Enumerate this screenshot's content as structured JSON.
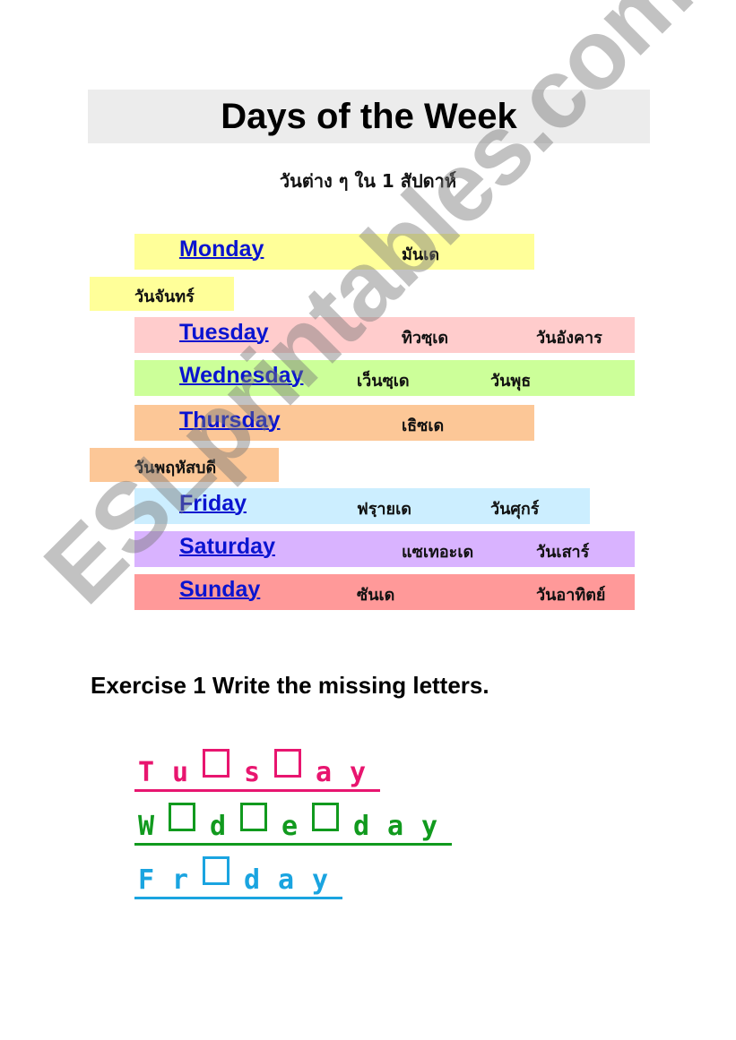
{
  "header": {
    "title": "Days of the Week",
    "subtitle": "วันต่าง ๆ ใน 1 สัปดาห์"
  },
  "days": [
    {
      "english": "Monday",
      "pronunciation": "มันเด",
      "thai": "วันจันทร์",
      "color": "#ffff99"
    },
    {
      "english": "Tuesday",
      "pronunciation": "ทิวซฺเด",
      "thai": "วันอังคาร",
      "color": "#ffcccc"
    },
    {
      "english": "Wednesday",
      "pronunciation": "เว็นซฺเด",
      "thai": "วันพุธ",
      "color": "#ccff99"
    },
    {
      "english": "Thursday",
      "pronunciation": "เธิซเด",
      "thai": "วันพฤหัสบดี",
      "color": "#fcc797"
    },
    {
      "english": "Friday",
      "pronunciation": "ฟรฺายเด",
      "thai": "วันศุกร์",
      "color": "#cceeff"
    },
    {
      "english": "Saturday",
      "pronunciation": "แซเทอะเด",
      "thai": "วันเสาร์",
      "color": "#d9b3ff"
    },
    {
      "english": "Sunday",
      "pronunciation": "ซันเด",
      "thai": "วันอาทิตย์",
      "color": "#ff9999"
    }
  ],
  "exercise": {
    "heading": "Exercise 1 Write the missing letters.",
    "words": [
      {
        "letters": [
          "T",
          "u",
          "_",
          "s",
          "_",
          "a",
          "y"
        ],
        "color": "#e8156f"
      },
      {
        "letters": [
          "W",
          "_",
          "d",
          "_",
          "e",
          "_",
          "d",
          "a",
          "y"
        ],
        "color": "#119a1e"
      },
      {
        "letters": [
          "F",
          "r",
          "_",
          "d",
          "a",
          "y"
        ],
        "color": "#1aa4e0"
      }
    ]
  },
  "watermark": "ESLprintables.com"
}
